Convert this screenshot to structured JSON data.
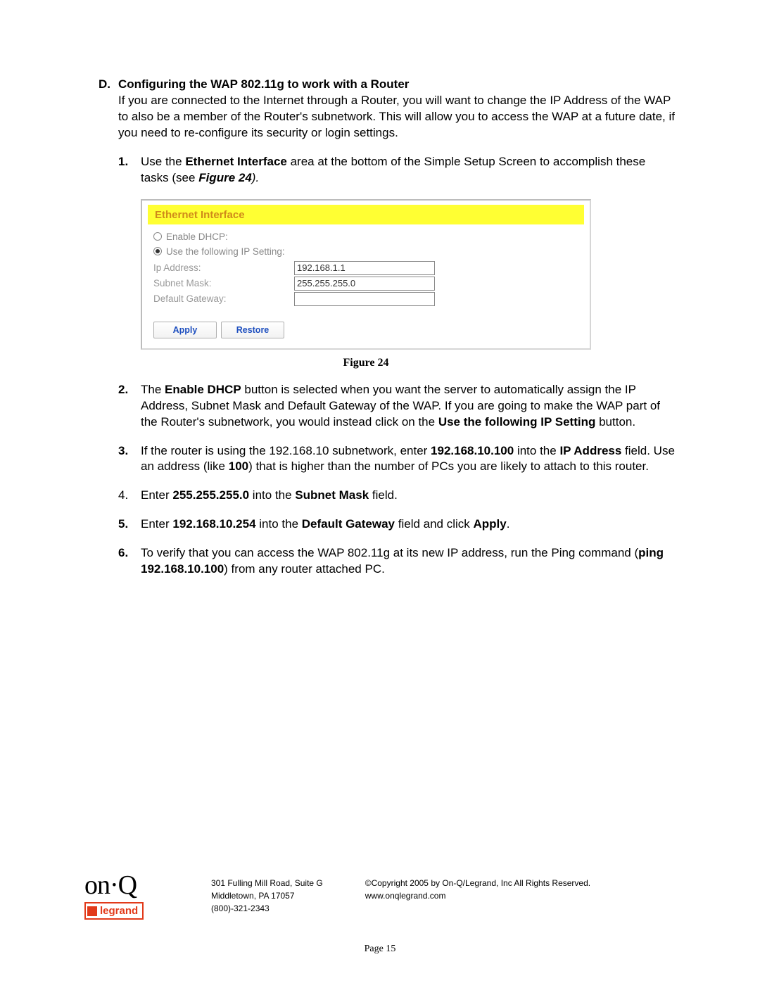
{
  "section": {
    "letter": "D.",
    "title": "Configuring the WAP 802.11g to work with a Router",
    "intro": "If you are connected to the Internet through a Router, you will want to change the IP Address of the WAP to also be a member of the Router's subnetwork. This will allow you to access the WAP at a future date, if you need to re-configure its security or login settings."
  },
  "step1": {
    "num": "1.",
    "pre": "Use the ",
    "bold1": "Ethernet Interface",
    "mid": " area at the bottom of the Simple Setup Screen to accomplish these tasks (see ",
    "figref": "Figure 24",
    "post": ")."
  },
  "ethernet": {
    "title": "Ethernet Interface",
    "radio_dhcp": "Enable DHCP:",
    "radio_static": "Use the following IP Setting:",
    "label_ip": "Ip Address:",
    "label_mask": "Subnet Mask:",
    "label_gw": "Default Gateway:",
    "val_ip": "192.168.1.1",
    "val_mask": "255.255.255.0",
    "val_gw": "",
    "btn_apply": "Apply",
    "btn_restore": "Restore"
  },
  "figure_caption": "Figure 24",
  "step2": {
    "num": "2.",
    "t1": "The ",
    "b1": "Enable DHCP",
    "t2": " button is selected when you want the server to automatically assign the IP Address, Subnet Mask and Default Gateway of the WAP. If you are going to make the WAP part of the Router's subnetwork, you would instead click on the ",
    "b2": "Use the following IP Setting",
    "t3": " button."
  },
  "step3": {
    "num": "3.",
    "t1": "If the router is using the 192.168.10 subnetwork, enter ",
    "b1": "192.168.10.100",
    "t2": " into the ",
    "b2": "IP Address",
    "t3": " field. Use an address (like ",
    "b3": "100",
    "t4": ") that is higher than the number of PCs you are likely to attach to this router."
  },
  "step4": {
    "num": "4.",
    "t1": "Enter ",
    "b1": "255.255.255.0",
    "t2": " into the ",
    "b2": "Subnet Mask",
    "t3": " field."
  },
  "step5": {
    "num": "5.",
    "t1": "Enter ",
    "b1": "192.168.10.254",
    "t2": " into the ",
    "b2": "Default Gateway",
    "t3": " field and click ",
    "b3": "Apply",
    "t4": "."
  },
  "step6": {
    "num": "6.",
    "t1": "To verify that you can access the WAP 802.11g at its new IP address, run the Ping command (",
    "b1": "ping 192.168.10.100",
    "t2": ") from any router attached PC."
  },
  "footer": {
    "addr1": "301 Fulling Mill Road, Suite G",
    "addr2": "Middletown, PA   17057",
    "addr3": "(800)-321-2343",
    "copy": "©Copyright 2005 by On-Q/Legrand, Inc All Rights Reserved.",
    "url": "www.onqlegrand.com",
    "logo_onq": "on·Q",
    "logo_legrand": "legrand",
    "page": "Page 15"
  }
}
